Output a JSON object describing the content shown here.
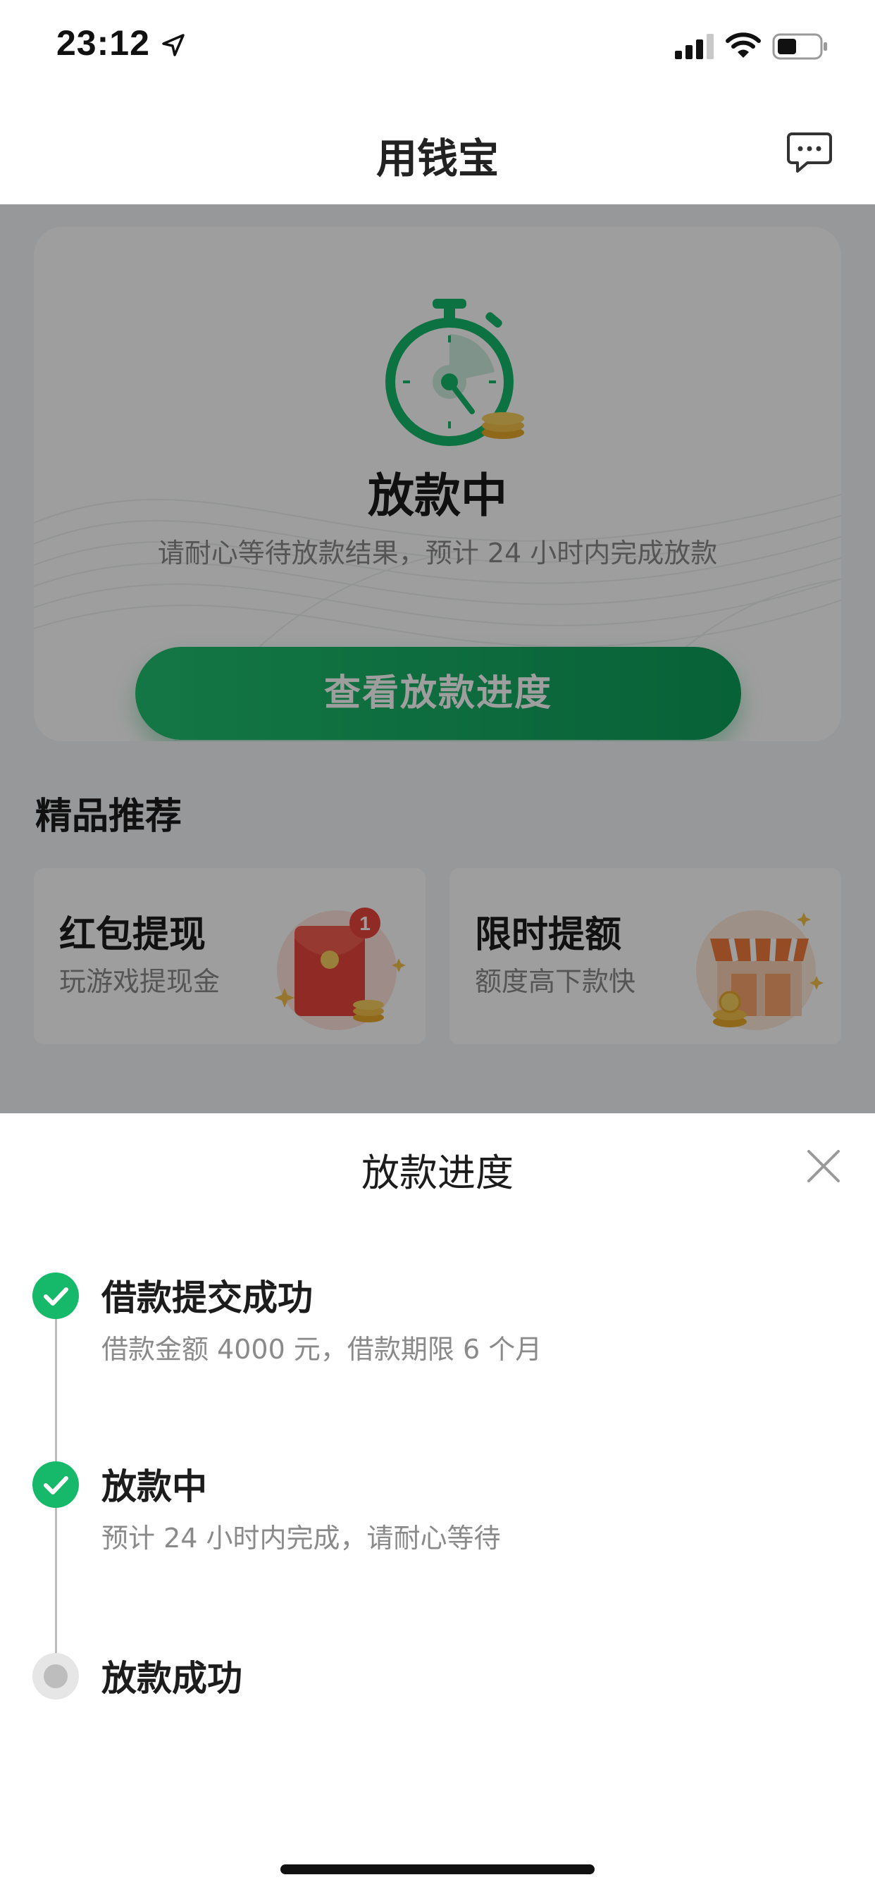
{
  "status_bar": {
    "time": "23:12"
  },
  "nav": {
    "title": "用钱宝"
  },
  "status_card": {
    "title": "放款中",
    "description": "请耐心等待放款结果，预计 24 小时内完成放款",
    "button_label": "查看放款进度"
  },
  "recommend": {
    "section_title": "精品推荐",
    "cards": [
      {
        "title": "红包提现",
        "subtitle": "玩游戏提现金",
        "badge": "1"
      },
      {
        "title": "限时提额",
        "subtitle": "额度高下款快"
      }
    ]
  },
  "sheet": {
    "title": "放款进度",
    "steps": [
      {
        "title": "借款提交成功",
        "description": "借款金额 4000 元，借款期限 6 个月",
        "status": "done"
      },
      {
        "title": "放款中",
        "description": "预计 24 小时内完成，请耐心等待",
        "status": "done"
      },
      {
        "title": "放款成功",
        "status": "pending"
      }
    ]
  },
  "colors": {
    "accent": "#16b86a",
    "overlay": "rgba(0,0,0,0.38)"
  }
}
